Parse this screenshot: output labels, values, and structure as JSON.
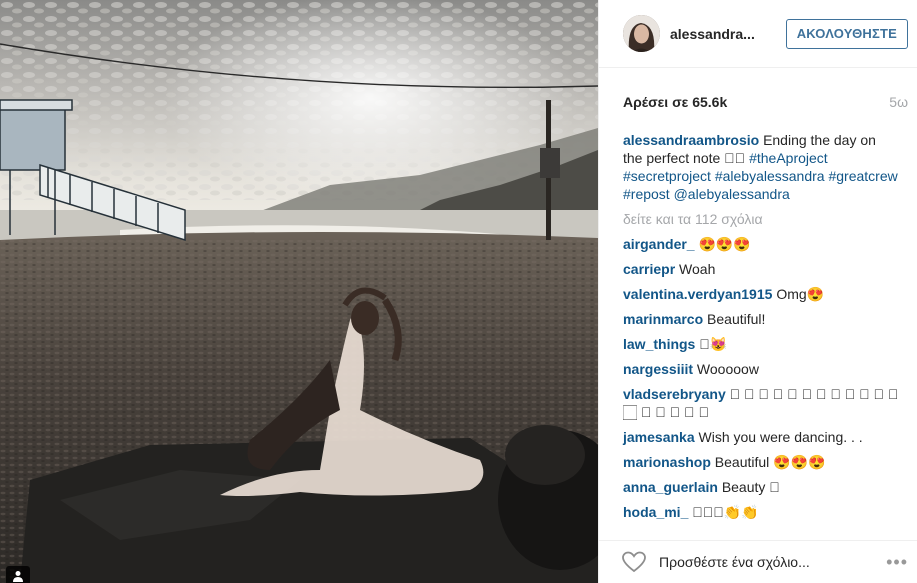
{
  "header": {
    "username": "alessandra...",
    "follow_label": "ΑΚΟΛΟΥΘΗΣΤΕ"
  },
  "stats": {
    "likes": "Αρέσει σε 65.6k",
    "time_ago": "5ω"
  },
  "caption": {
    "user": "alessandraambrosio",
    "text": "Ending the day on the perfect note 🏻🏼",
    "tags": [
      "#theAproject",
      "#secretproject",
      "#alebyalessandra",
      "#greatcrew",
      "#repost",
      "@alebyalessandra"
    ]
  },
  "view_all": "δείτε και τα 112 σχόλια",
  "comments": [
    {
      "user": "airgander_",
      "text": "😍😍😍"
    },
    {
      "user": "carriepr",
      "text": "Woah"
    },
    {
      "user": "valentina.verdyan1915",
      "text": "Omg😍"
    },
    {
      "user": "marinmarco",
      "text": "Beautiful!"
    },
    {
      "user": "law_things",
      "text": "🏻😻"
    },
    {
      "user": "nargessiiit",
      "text": "Wooooow"
    },
    {
      "user": "vladserebryany",
      "text": "🏻 🏻 🏻 🏻 🏻 🏻 🏻 🏻 🏻 🏻 🏻 🏻 🏻 🏻 🏻 🏻 🏻 🏻"
    },
    {
      "user": "jamesanka",
      "text": "Wish you were dancing. . ."
    },
    {
      "user": "marionashop",
      "text": "Beautiful 😍😍😍"
    },
    {
      "user": "anna_guerlain",
      "text": "Beauty 🏻"
    },
    {
      "user": "hoda_mi_",
      "text": "🏻🏻🏻👏👏"
    }
  ],
  "footer": {
    "add_comment_placeholder": "Προσθέστε ένα σχόλιο...",
    "more_label": "•••",
    "icons": {
      "like": "heart-icon",
      "options": "more-options-icon",
      "tag": "person-tag-icon"
    }
  },
  "colors": {
    "link": "#125688",
    "follow": "#3f729b",
    "muted": "#a5a7aa"
  }
}
